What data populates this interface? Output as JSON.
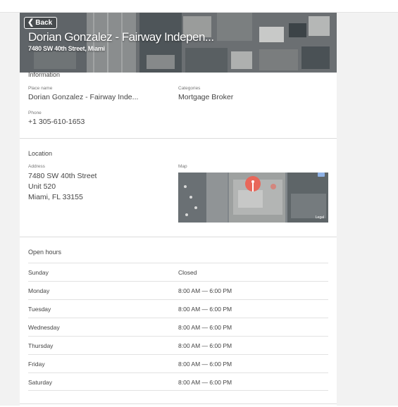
{
  "header": {
    "back_label": "Back",
    "title": "Dorian Gonzalez - Fairway Indepen...",
    "address": "7480 SW 40th Street, Miami"
  },
  "information": {
    "section_title": "Information",
    "place_name_label": "Place name",
    "place_name": "Dorian Gonzalez - Fairway Inde...",
    "categories_label": "Categories",
    "categories": "Mortgage Broker",
    "phone_label": "Phone",
    "phone": "+1 305-610-1653"
  },
  "location": {
    "section_title": "Location",
    "address_label": "Address",
    "address_lines": [
      "7480 SW 40th Street",
      "Unit 520",
      "Miami, FL 33155"
    ],
    "map_label": "Map",
    "map_legal": "Legal"
  },
  "open_hours": {
    "section_title": "Open hours",
    "rows": [
      {
        "day": "Sunday",
        "time": "Closed"
      },
      {
        "day": "Monday",
        "time": "8:00 AM — 6:00 PM"
      },
      {
        "day": "Tuesday",
        "time": "8:00 AM — 6:00 PM"
      },
      {
        "day": "Wednesday",
        "time": "8:00 AM — 6:00 PM"
      },
      {
        "day": "Thursday",
        "time": "8:00 AM — 6:00 PM"
      },
      {
        "day": "Friday",
        "time": "8:00 AM — 6:00 PM"
      },
      {
        "day": "Saturday",
        "time": "8:00 AM — 6:00 PM"
      }
    ]
  },
  "colors": {
    "pin": "#e8675a",
    "divider": "#dcdcdc",
    "page_bg": "#f2f2f2"
  },
  "icons": [
    "chevron-left-icon",
    "map-pin-icon",
    "info-icon"
  ]
}
